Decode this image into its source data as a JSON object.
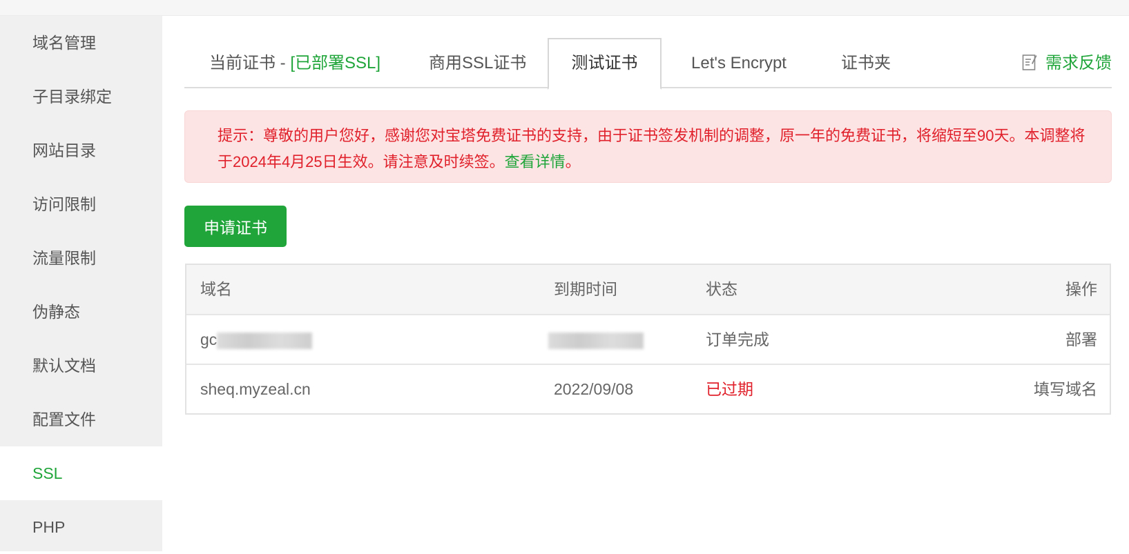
{
  "sidebar": {
    "items": [
      {
        "label": "域名管理"
      },
      {
        "label": "子目录绑定"
      },
      {
        "label": "网站目录"
      },
      {
        "label": "访问限制"
      },
      {
        "label": "流量限制"
      },
      {
        "label": "伪静态"
      },
      {
        "label": "默认文档"
      },
      {
        "label": "配置文件"
      },
      {
        "label": "SSL",
        "active": true
      },
      {
        "label": "PHP"
      }
    ]
  },
  "tabs": {
    "current_prefix": "当前证书 - ",
    "current_status": "[已部署SSL]",
    "commercial": "商用SSL证书",
    "test": "测试证书",
    "letsencrypt": "Let's Encrypt",
    "folder": "证书夹",
    "feedback": "需求反馈"
  },
  "notice": {
    "text": "提示：尊敬的用户您好，感谢您对宝塔免费证书的支持，由于证书签发机制的调整，原一年的免费证书，将缩短至90天。本调整将于2024年4月25日生效。请注意及时续签。",
    "link": "查看详情",
    "end": "。"
  },
  "apply_button": "申请证书",
  "table": {
    "headers": {
      "domain": "域名",
      "expire": "到期时间",
      "status": "状态",
      "action": "操作"
    },
    "rows": [
      {
        "domain": "gc",
        "expire": "",
        "status": "订单完成",
        "action": "部署"
      },
      {
        "domain": "sheq.myzeal.cn",
        "expire": "2022/09/08",
        "status": "已过期",
        "action": "填写域名"
      }
    ]
  },
  "colors": {
    "accent": "#20a53a",
    "danger": "#e0202a",
    "notice_bg": "#fce4e4"
  }
}
